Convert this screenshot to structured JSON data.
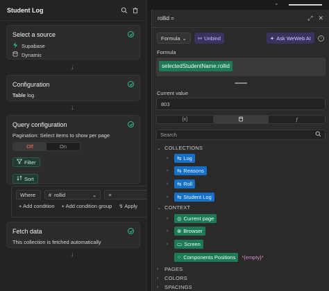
{
  "left_panel": {
    "title": "Student Log",
    "cards": {
      "source": {
        "title": "Select a source",
        "items": [
          "Supabase",
          "Dynamic"
        ]
      },
      "configuration": {
        "title": "Configuration",
        "table_label": "Table",
        "table_value": "log"
      },
      "query": {
        "title": "Query configuration",
        "pagination_text": "Pagination: Select items to show per page",
        "toggle_off": "Off",
        "toggle_on": "On",
        "filter_label": "Filter",
        "sort_label": "Sort"
      },
      "where": {
        "label": "Where",
        "field_prefix": "#",
        "field": "rollid",
        "operator": "=",
        "add_condition": "+ Add condition",
        "add_condition_group": "+ Add condition group",
        "apply": "Apply"
      },
      "fetch": {
        "title": "Fetch data",
        "text": "This collection is fetched automatically"
      }
    }
  },
  "right_panel": {
    "title": "rollid =",
    "toolbar": {
      "formula": "Formula",
      "unbind": "Unbind",
      "ask_ai": "Ask WeWeb AI"
    },
    "formula_label": "Formula",
    "formula_chip": "selectedStudentName.rollid",
    "current_value_label": "Current value",
    "current_value": "803",
    "search_placeholder": "Search",
    "sections": {
      "collections": "COLLECTIONS",
      "context": "CONTEXT",
      "pages": "PAGES",
      "colors": "COLORS",
      "spacings": "SPACINGS"
    },
    "collections": [
      "Log",
      "Reasons",
      "Roll",
      "Student Log"
    ],
    "context": {
      "current_page": "Current page",
      "browser": "Browser",
      "screen": "Screen",
      "components_positions": "Components Positions",
      "components_positions_value": "*{empty}*"
    }
  },
  "colors": {
    "green_check": "#29c38a",
    "blue_chip": "#1570c6",
    "green_chip": "#1d7a55",
    "purple": "#3a3360"
  }
}
